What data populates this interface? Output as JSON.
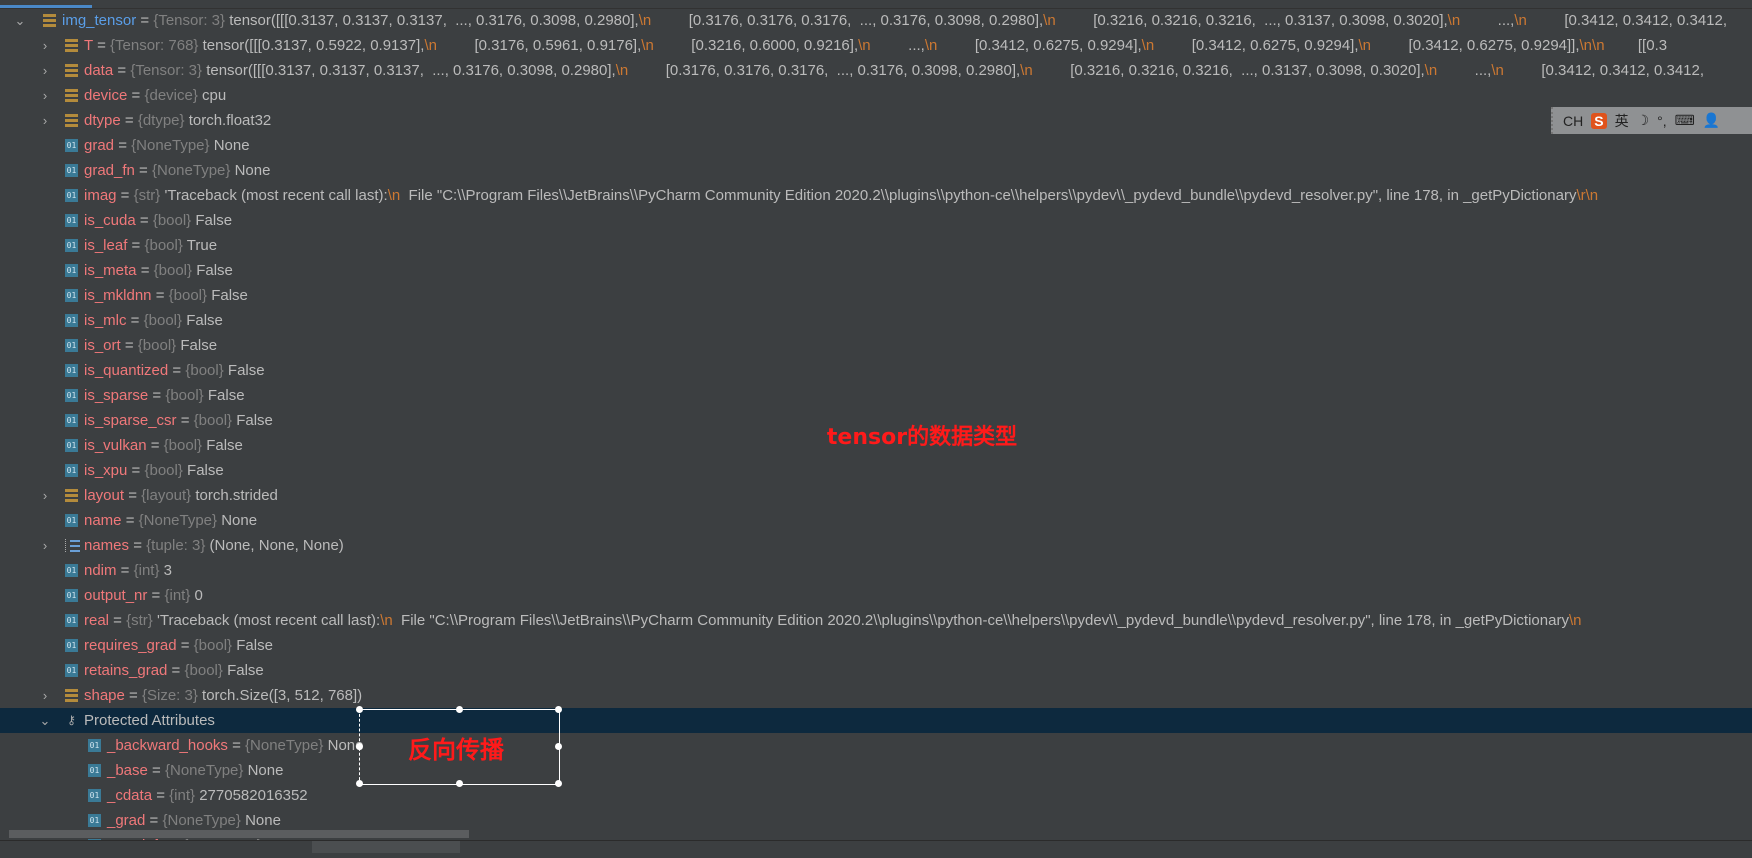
{
  "rows": [
    {
      "level": 0,
      "arrow": "open",
      "icon": "list",
      "name": "img_tensor",
      "type": "{Tensor: 3}",
      "value": "tensor([[[0.3137, 0.3137, 0.3137,  ..., 0.3176, 0.3098, 0.2980],\\n         [0.3176, 0.3176, 0.3176,  ..., 0.3176, 0.3098, 0.2980],\\n         [0.3216, 0.3216, 0.3216,  ..., 0.3137, 0.3098, 0.3020],\\n         ...,\\n         [0.3412, 0.3412, 0.3412,",
      "root": true
    },
    {
      "level": 1,
      "arrow": "closed",
      "icon": "list",
      "name": "T",
      "type": "{Tensor: 768}",
      "value": "tensor([[[0.3137, 0.5922, 0.9137],\\n         [0.3176, 0.5961, 0.9176],\\n         [0.3216, 0.6000, 0.9216],\\n         ...,\\n         [0.3412, 0.6275, 0.9294],\\n         [0.3412, 0.6275, 0.9294],\\n         [0.3412, 0.6275, 0.9294]],\\n\\n        [[0.3"
    },
    {
      "level": 1,
      "arrow": "closed",
      "icon": "list",
      "name": "data",
      "type": "{Tensor: 3}",
      "value": "tensor([[[0.3137, 0.3137, 0.3137,  ..., 0.3176, 0.3098, 0.2980],\\n         [0.3176, 0.3176, 0.3176,  ..., 0.3176, 0.3098, 0.2980],\\n         [0.3216, 0.3216, 0.3216,  ..., 0.3137, 0.3098, 0.3020],\\n         ...,\\n         [0.3412, 0.3412, 0.3412,"
    },
    {
      "level": 1,
      "arrow": "closed",
      "icon": "list",
      "name": "device",
      "type": "{device}",
      "value": "cpu"
    },
    {
      "level": 1,
      "arrow": "closed",
      "icon": "list",
      "name": "dtype",
      "type": "{dtype}",
      "value": "torch.float32"
    },
    {
      "level": 1,
      "icon": "num",
      "name": "grad",
      "type": "{NoneType}",
      "value": "None"
    },
    {
      "level": 1,
      "icon": "num",
      "name": "grad_fn",
      "type": "{NoneType}",
      "value": "None"
    },
    {
      "level": 1,
      "icon": "num",
      "name": "imag",
      "type": "{str}",
      "value": "'Traceback (most recent call last):\\n  File \"C:\\\\Program Files\\\\JetBrains\\\\PyCharm Community Edition 2020.2\\\\plugins\\\\python-ce\\\\helpers\\\\pydev\\\\_pydevd_bundle\\\\pydevd_resolver.py\", line 178, in _getPyDictionary\\r\\n"
    },
    {
      "level": 1,
      "icon": "num",
      "name": "is_cuda",
      "type": "{bool}",
      "value": "False"
    },
    {
      "level": 1,
      "icon": "num",
      "name": "is_leaf",
      "type": "{bool}",
      "value": "True"
    },
    {
      "level": 1,
      "icon": "num",
      "name": "is_meta",
      "type": "{bool}",
      "value": "False"
    },
    {
      "level": 1,
      "icon": "num",
      "name": "is_mkldnn",
      "type": "{bool}",
      "value": "False"
    },
    {
      "level": 1,
      "icon": "num",
      "name": "is_mlc",
      "type": "{bool}",
      "value": "False"
    },
    {
      "level": 1,
      "icon": "num",
      "name": "is_ort",
      "type": "{bool}",
      "value": "False"
    },
    {
      "level": 1,
      "icon": "num",
      "name": "is_quantized",
      "type": "{bool}",
      "value": "False"
    },
    {
      "level": 1,
      "icon": "num",
      "name": "is_sparse",
      "type": "{bool}",
      "value": "False"
    },
    {
      "level": 1,
      "icon": "num",
      "name": "is_sparse_csr",
      "type": "{bool}",
      "value": "False"
    },
    {
      "level": 1,
      "icon": "num",
      "name": "is_vulkan",
      "type": "{bool}",
      "value": "False"
    },
    {
      "level": 1,
      "icon": "num",
      "name": "is_xpu",
      "type": "{bool}",
      "value": "False"
    },
    {
      "level": 1,
      "arrow": "closed",
      "icon": "list",
      "name": "layout",
      "type": "{layout}",
      "value": "torch.strided"
    },
    {
      "level": 1,
      "icon": "num",
      "name": "name",
      "type": "{NoneType}",
      "value": "None"
    },
    {
      "level": 1,
      "arrow": "closed",
      "icon": "tup",
      "name": "names",
      "type": "{tuple: 3}",
      "value": "(None, None, None)"
    },
    {
      "level": 1,
      "icon": "num",
      "name": "ndim",
      "type": "{int}",
      "value": "3"
    },
    {
      "level": 1,
      "icon": "num",
      "name": "output_nr",
      "type": "{int}",
      "value": "0"
    },
    {
      "level": 1,
      "icon": "num",
      "name": "real",
      "type": "{str}",
      "value": "'Traceback (most recent call last):\\n  File \"C:\\\\Program Files\\\\JetBrains\\\\PyCharm Community Edition 2020.2\\\\plugins\\\\python-ce\\\\helpers\\\\pydev\\\\_pydevd_bundle\\\\pydevd_resolver.py\", line 178, in _getPyDictionary\\n  "
    },
    {
      "level": 1,
      "icon": "num",
      "name": "requires_grad",
      "type": "{bool}",
      "value": "False"
    },
    {
      "level": 1,
      "icon": "num",
      "name": "retains_grad",
      "type": "{bool}",
      "value": "False"
    },
    {
      "level": 1,
      "arrow": "closed",
      "icon": "list",
      "name": "shape",
      "type": "{Size: 3}",
      "value": "torch.Size([3, 512, 768])"
    },
    {
      "level": 1,
      "arrow": "open",
      "icon": "key",
      "name": "Protected Attributes",
      "group": true,
      "selected": true
    },
    {
      "level": 2,
      "icon": "num",
      "name": "_backward_hooks",
      "type": "{NoneType}",
      "value": "None"
    },
    {
      "level": 2,
      "icon": "num",
      "name": "_base",
      "type": "{NoneType}",
      "value": "None"
    },
    {
      "level": 2,
      "icon": "num",
      "name": "_cdata",
      "type": "{int}",
      "value": "2770582016352"
    },
    {
      "level": 2,
      "icon": "num",
      "name": "_grad",
      "type": "{NoneType}",
      "value": "None"
    },
    {
      "level": 2,
      "icon": "num",
      "name": "_grad_fn",
      "type": "{NoneType}",
      "value": "None"
    }
  ],
  "annotations": {
    "dtype_note": "tensor的数据类型",
    "backward_note": "反向传播"
  },
  "ime": {
    "lang": "CH",
    "logo": "S",
    "mode": "英"
  },
  "colors": {
    "background": "#3c3f41",
    "selected_row": "#0d293e",
    "name": "#f0787a",
    "root_name": "#5a9ee8",
    "type": "#808080",
    "newline": "#cc7832",
    "annotation": "#ff1a1a"
  }
}
